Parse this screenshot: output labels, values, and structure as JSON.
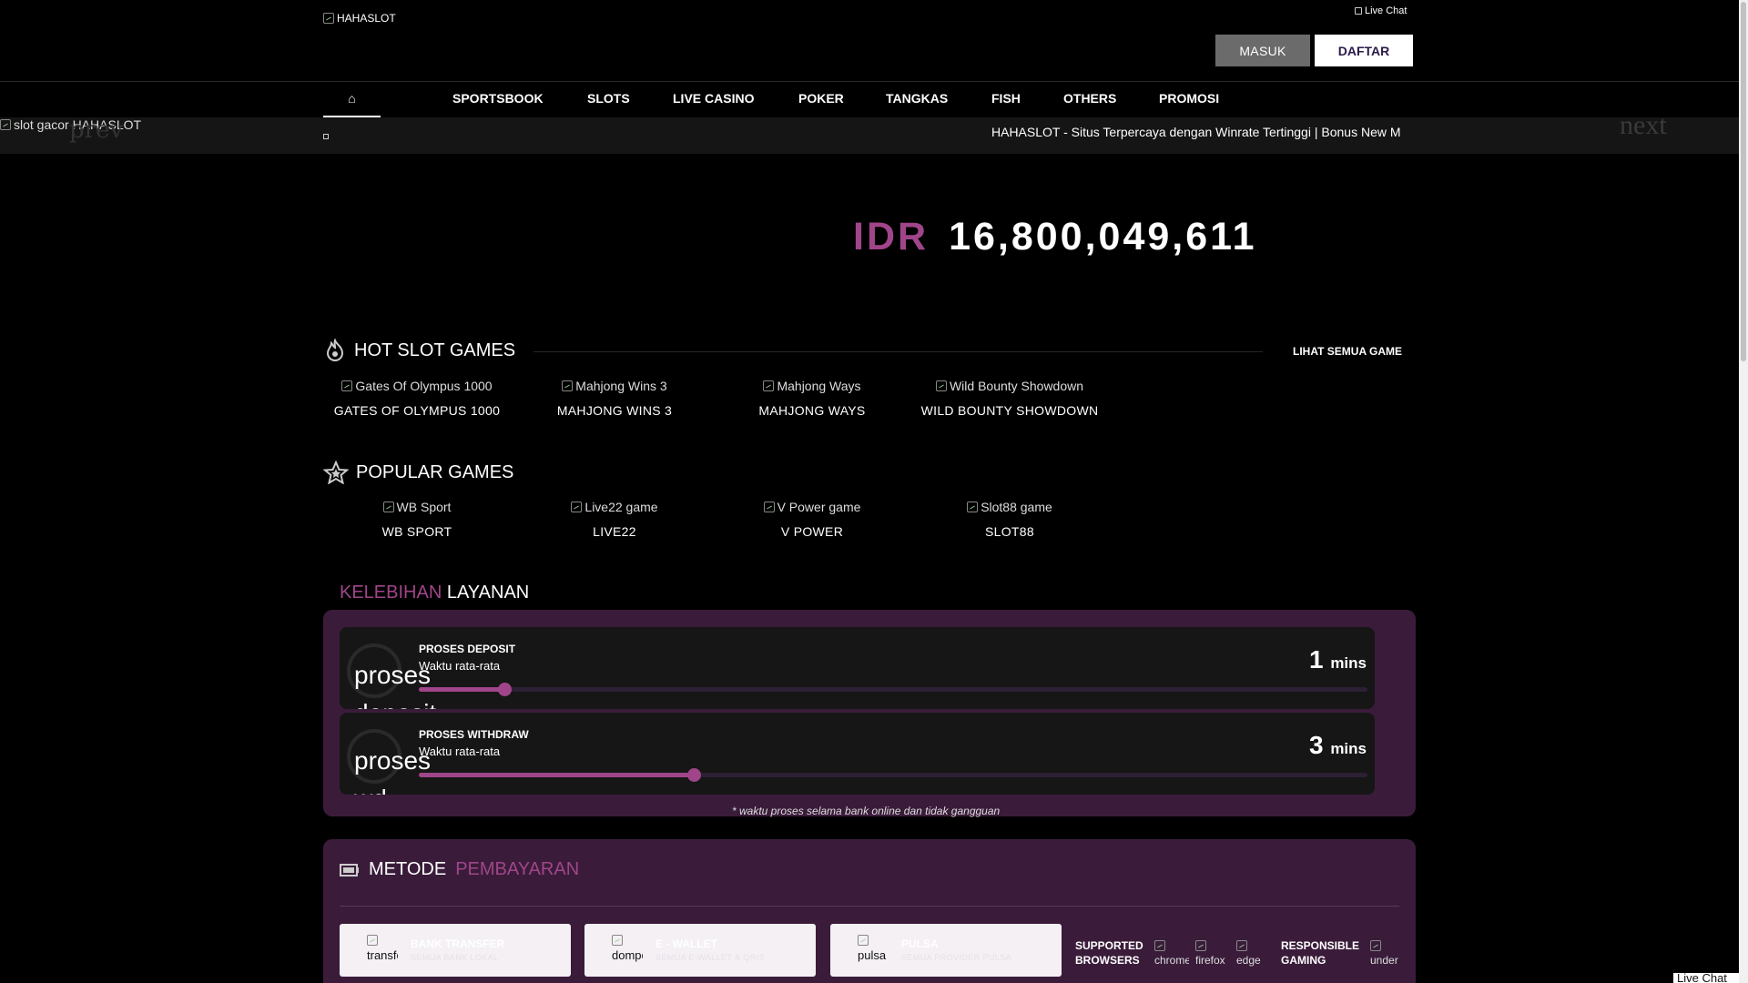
{
  "header": {
    "logo_alt": "HAHASLOT",
    "live_chat": "Live Chat",
    "login_label": "MASUK",
    "register_label": "DAFTAR"
  },
  "nav": {
    "home_icon": "home-icon",
    "items": [
      "SPORTSBOOK",
      "SLOTS",
      "LIVE CASINO",
      "POKER",
      "TANGKAS",
      "FISH",
      "OTHERS",
      "PROMOSI"
    ]
  },
  "banner": {
    "image_alt": "slot gacor HAHASLOT",
    "prev_label": "prev",
    "next_label": "next"
  },
  "announcement": {
    "icon": "speaker-icon",
    "text": "HAHASLOT - Situs Terpercaya dengan Winrate Tertinggi | Bonus New M"
  },
  "jackpot": {
    "currency": "IDR",
    "amount": "16,800,049,611"
  },
  "hot_slots": {
    "icon": "fire-icon",
    "title": "HOT SLOT GAMES",
    "see_all": "LIHAT SEMUA GAME",
    "games": [
      {
        "alt": "Gates Of Olympus 1000",
        "name": "GATES OF OLYMPUS 1000"
      },
      {
        "alt": "Mahjong Wins 3",
        "name": "MAHJONG WINS 3"
      },
      {
        "alt": "Mahjong Ways",
        "name": "MAHJONG WAYS"
      },
      {
        "alt": "Wild Bounty Showdown",
        "name": "WILD BOUNTY SHOWDOWN"
      }
    ]
  },
  "popular": {
    "icon": "star-icon",
    "title": "POPULAR GAMES",
    "games": [
      {
        "alt": "WB Sport",
        "name": "WB SPORT"
      },
      {
        "alt": "Live22 game",
        "name": "LIVE22"
      },
      {
        "alt": "V Power game",
        "name": "V POWER"
      },
      {
        "alt": "Slot88 game",
        "name": "SLOT88"
      }
    ]
  },
  "kelebihan": {
    "title_a": "KELEBIHAN",
    "title_b": "LAYANAN",
    "deposit": {
      "icon_alt": "proses deposit",
      "title": "PROSES DEPOSIT",
      "subtitle": "Waktu rata-rata",
      "value": "1",
      "unit": "mins",
      "level": 0.09
    },
    "withdraw": {
      "icon_alt": "proses wd",
      "title": "PROSES WITHDRAW",
      "subtitle": "Waktu rata-rata",
      "value": "3",
      "unit": "mins",
      "level": 0.29
    },
    "note": "* waktu proses selama bank online dan tidak gangguan"
  },
  "metode": {
    "icon": "wallet-icon",
    "title_a": "METODE",
    "title_b": "PEMBAYARAN",
    "cards": [
      {
        "img_alt": "transfer",
        "title": "BANK TRANSFER",
        "subtitle": "SEMUA BANK LOKAL"
      },
      {
        "img_alt": "dompet",
        "title": "E - WALLET",
        "subtitle": "SEMUA E-WALLET & QRIS"
      },
      {
        "img_alt": "pulsa",
        "title": "PULSA",
        "subtitle": "SEMUA PROVIDER PULSA"
      }
    ],
    "supported_line1": "SUPPORTED",
    "supported_line2": "BROWSERS",
    "browsers": [
      "chrome",
      "firefox",
      "edge"
    ],
    "responsible_line1": "RESPONSIBLE",
    "responsible_line2": "GAMING",
    "responsible_img": "under"
  },
  "live_chat_widget": "Live Chat",
  "colors": {
    "accent": "#a0458a",
    "panel": "#3a1c3a",
    "background": "#000000"
  }
}
